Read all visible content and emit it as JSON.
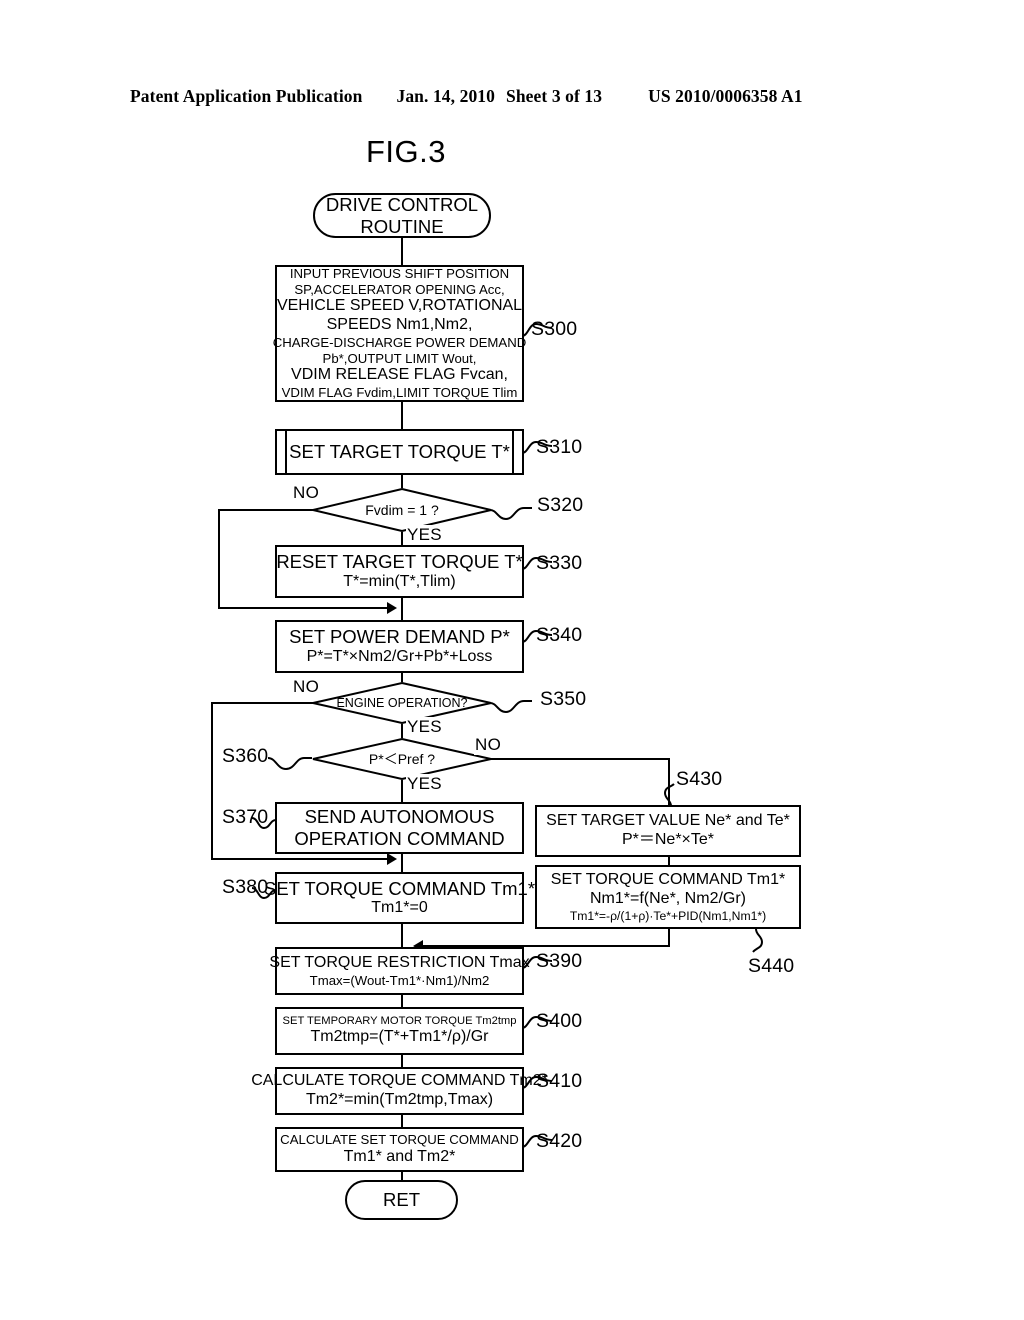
{
  "header": {
    "publication": "Patent Application Publication",
    "date": "Jan. 14, 2010",
    "sheet": "Sheet 3 of 13",
    "number": "US 2010/0006358 A1"
  },
  "figure": {
    "label": "FIG.3"
  },
  "flow": {
    "start": {
      "id": "start",
      "shape": "terminator",
      "lines": [
        "DRIVE CONTROL",
        "ROUTINE"
      ]
    },
    "s300": {
      "id": "S300",
      "shape": "process",
      "lines": [
        "INPUT PREVIOUS SHIFT POSITION",
        "SP,ACCELERATOR OPENING Acc,",
        "VEHICLE SPEED V,ROTATIONAL",
        "SPEEDS Nm1,Nm2,",
        "CHARGE-DISCHARGE POWER DEMAND",
        "Pb*,OUTPUT LIMIT Wout,",
        "VDIM RELEASE FLAG Fvcan,",
        "VDIM FLAG Fvdim,LIMIT TORQUE Tlim"
      ]
    },
    "s310": {
      "id": "S310",
      "shape": "predefined-process",
      "lines": [
        "SET TARGET TORQUE T*"
      ]
    },
    "s320": {
      "id": "S320",
      "shape": "decision",
      "condition": "Fvdim = 1  ?",
      "yes_label": "YES",
      "no_label": "NO"
    },
    "s330": {
      "id": "S330",
      "shape": "process",
      "lines": [
        "RESET TARGET TORQUE T*",
        "T*=min(T*,Tlim)"
      ]
    },
    "s340": {
      "id": "S340",
      "shape": "process",
      "lines": [
        "SET POWER DEMAND P*",
        "P*=T*×Nm2/Gr+Pb*+Loss"
      ]
    },
    "s350": {
      "id": "S350",
      "shape": "decision",
      "condition": "ENGINE OPERATION?",
      "yes_label": "YES",
      "no_label": "NO"
    },
    "s360": {
      "id": "S360",
      "shape": "decision",
      "condition": "P*＜Pref ?",
      "yes_label": "YES",
      "no_label": "NO"
    },
    "s370": {
      "id": "S370",
      "shape": "process",
      "lines": [
        "SEND AUTONOMOUS",
        "OPERATION COMMAND"
      ]
    },
    "s380": {
      "id": "S380",
      "shape": "process",
      "lines": [
        "SET TORQUE COMMAND Tm1*",
        "Tm1*=0"
      ]
    },
    "s430": {
      "id": "S430",
      "shape": "process",
      "lines": [
        "SET TARGET VALUE Ne* and Te*",
        "P*＝Ne*×Te*"
      ]
    },
    "s440": {
      "id": "S440",
      "shape": "process",
      "lines": [
        "SET TORQUE COMMAND Tm1*",
        "Nm1*=f(Ne*, Nm2/Gr)",
        "Tm1*=-ρ/(1+ρ)·Te*+PID(Nm1,Nm1*)"
      ]
    },
    "s390": {
      "id": "S390",
      "shape": "process",
      "lines": [
        "SET TORQUE RESTRICTION Tmax",
        "Tmax=(Wout-Tm1*·Nm1)/Nm2"
      ]
    },
    "s400": {
      "id": "S400",
      "shape": "process",
      "lines": [
        "SET TEMPORARY MOTOR TORQUE Tm2tmp",
        "Tm2tmp=(T*+Tm1*/ρ)/Gr"
      ]
    },
    "s410": {
      "id": "S410",
      "shape": "process",
      "lines": [
        "CALCULATE  TORQUE COMMAND Tm2*",
        "Tm2*=min(Tm2tmp,Tmax)"
      ]
    },
    "s420": {
      "id": "S420",
      "shape": "process",
      "lines": [
        "CALCULATE  SET TORQUE COMMAND",
        "Tm1* and Tm2*"
      ]
    },
    "end": {
      "id": "end",
      "shape": "terminator",
      "lines": [
        "RET"
      ]
    }
  },
  "step_refs": {
    "s300": "S300",
    "s310": "S310",
    "s320": "S320",
    "s330": "S330",
    "s340": "S340",
    "s350": "S350",
    "s360": "S360",
    "s370": "S370",
    "s380": "S380",
    "s390": "S390",
    "s400": "S400",
    "s410": "S410",
    "s420": "S420",
    "s430": "S430",
    "s440": "S440"
  },
  "branch_labels": {
    "s320_no": "NO",
    "s320_yes": "YES",
    "s350_no": "NO",
    "s350_yes": "YES",
    "s360_no": "NO",
    "s360_yes": "YES"
  }
}
